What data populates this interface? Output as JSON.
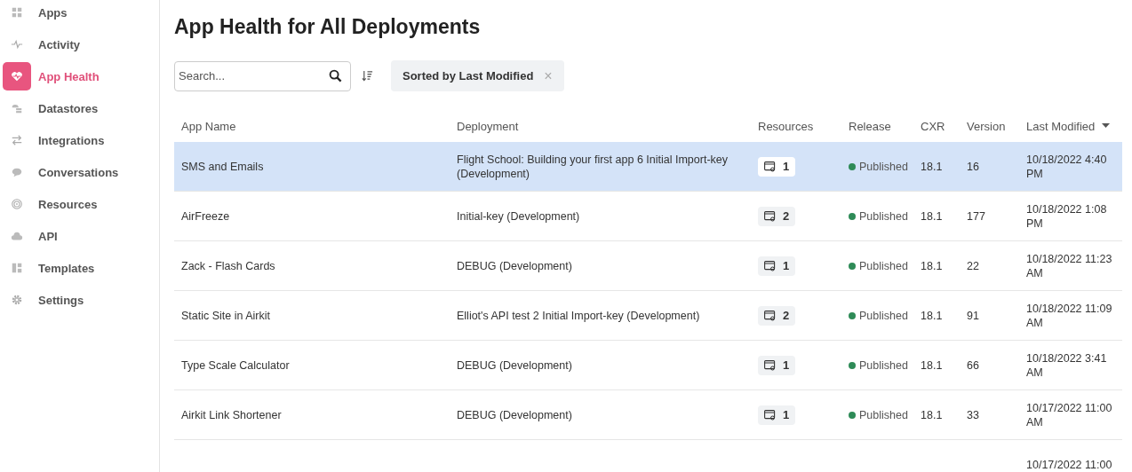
{
  "sidebar": {
    "items": [
      {
        "label": "Apps",
        "selected": false
      },
      {
        "label": "Activity",
        "selected": false
      },
      {
        "label": "App Health",
        "selected": true
      },
      {
        "label": "Datastores",
        "selected": false
      },
      {
        "label": "Integrations",
        "selected": false
      },
      {
        "label": "Conversations",
        "selected": false
      },
      {
        "label": "Resources",
        "selected": false
      },
      {
        "label": "API",
        "selected": false
      },
      {
        "label": "Templates",
        "selected": false
      },
      {
        "label": "Settings",
        "selected": false
      }
    ]
  },
  "page_title": "App Health for All Deployments",
  "search": {
    "placeholder": "Search..."
  },
  "sort_chip": {
    "label": "Sorted by Last Modified",
    "close": "×"
  },
  "table": {
    "columns": [
      "App Name",
      "Deployment",
      "Resources",
      "Release",
      "CXR",
      "Version",
      "Last Modified"
    ],
    "rows": [
      {
        "selected": true,
        "app_name": "SMS and Emails",
        "deployment": "Flight School: Building your first app 6 Initial Import-key (Development)",
        "resources": "1",
        "release": "Published",
        "color": "#2e8b57",
        "cxr": "18.1",
        "version": "16",
        "last_modified": "10/18/2022 4:40 PM"
      },
      {
        "selected": false,
        "app_name": "AirFreeze",
        "deployment": "Initial-key (Development)",
        "resources": "2",
        "release": "Published",
        "color": "#2e8b57",
        "cxr": "18.1",
        "version": "177",
        "last_modified": "10/18/2022 1:08 PM"
      },
      {
        "selected": false,
        "app_name": "Zack - Flash Cards",
        "deployment": "DEBUG (Development)",
        "resources": "1",
        "release": "Published",
        "color": "#2e8b57",
        "cxr": "18.1",
        "version": "22",
        "last_modified": "10/18/2022 11:23 AM"
      },
      {
        "selected": false,
        "app_name": "Static Site in Airkit",
        "deployment": "Elliot's API test 2 Initial Import-key (Development)",
        "resources": "2",
        "release": "Published",
        "color": "#2e8b57",
        "cxr": "18.1",
        "version": "91",
        "last_modified": "10/18/2022 11:09 AM"
      },
      {
        "selected": false,
        "app_name": "Type Scale Calculator",
        "deployment": "DEBUG (Development)",
        "resources": "1",
        "release": "Published",
        "color": "#2e8b57",
        "cxr": "18.1",
        "version": "66",
        "last_modified": "10/18/2022 3:41 AM"
      },
      {
        "selected": false,
        "app_name": "Airkit Link Shortener",
        "deployment": "DEBUG (Development)",
        "resources": "1",
        "release": "Published",
        "color": "#2e8b57",
        "cxr": "18.1",
        "version": "33",
        "last_modified": "10/17/2022 11:00 AM"
      },
      {
        "selected": false,
        "last_modified": "10/17/2022 11:00"
      }
    ]
  }
}
